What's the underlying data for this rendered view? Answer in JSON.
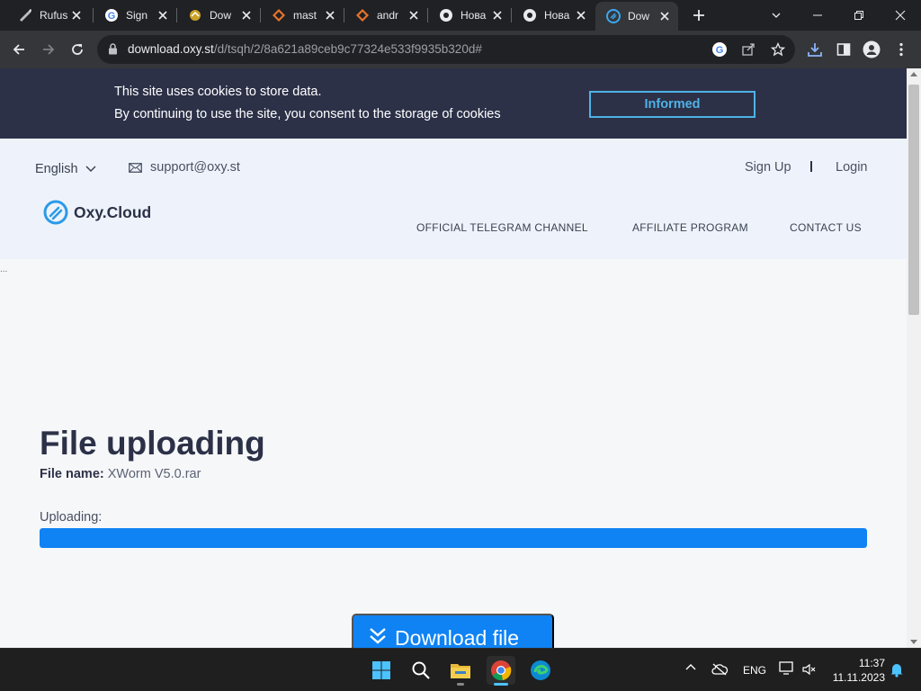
{
  "browser": {
    "tabs": [
      {
        "title": "Rufus",
        "icon": "rufus-icon"
      },
      {
        "title": "Sign",
        "icon": "google-icon"
      },
      {
        "title": "Dow",
        "icon": "download-site-icon"
      },
      {
        "title": "mast",
        "icon": "gitlab-icon"
      },
      {
        "title": "andr",
        "icon": "gitlab-icon"
      },
      {
        "title": "Нова",
        "icon": "chrome-icon"
      },
      {
        "title": "Нова",
        "icon": "chrome-icon"
      },
      {
        "title": "Dow",
        "icon": "oxy-cloud-icon",
        "active": true
      }
    ],
    "url_host": "download.oxy.st",
    "url_path": "/d/tsqh/2/8a621a89ceb9c77324e533f9935b320d#"
  },
  "cookie_banner": {
    "line1": "This site uses cookies to store data.",
    "line2": "By continuing to use the site, you consent to the storage of cookies",
    "button": "Informed"
  },
  "header": {
    "language": "English",
    "email": "support@oxy.st",
    "sign_up": "Sign Up",
    "login": "Login",
    "logo_text": "Oxy.Cloud",
    "nav": [
      "OFFICIAL TELEGRAM CHANNEL",
      "AFFILIATE PROGRAM",
      "CONTACT US"
    ]
  },
  "main": {
    "dots": "...",
    "title": "File uploading",
    "file_name_label": "File name:",
    "file_name": "XWorm V5.0.rar",
    "uploading_label": "Uploading:",
    "progress": 1.0,
    "download_button": "Download file"
  },
  "taskbar": {
    "language": "ENG",
    "time": "11:37",
    "date": "11.11.2023"
  },
  "colors": {
    "accent": "#0f83f4",
    "banner_bg": "#2c3148",
    "banner_button": "#4fb2e6",
    "header_bg": "#eef3fb"
  }
}
